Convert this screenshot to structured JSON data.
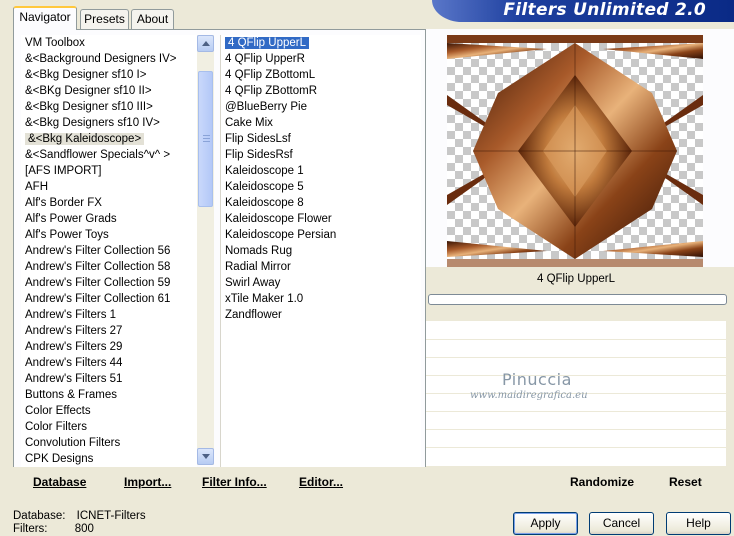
{
  "banner": {
    "title": "Filters Unlimited 2.0"
  },
  "tabs": [
    {
      "label": "Navigator",
      "active": true
    },
    {
      "label": "Presets",
      "active": false
    },
    {
      "label": "About",
      "active": false
    }
  ],
  "categories": {
    "items": [
      "VM Toolbox",
      "&<Background Designers IV>",
      "&<Bkg Designer sf10 I>",
      "&<BKg Designer sf10 II>",
      "&<Bkg Designer sf10 III>",
      "&<Bkg Designers sf10 IV>",
      "&<Bkg Kaleidoscope>",
      "&<Sandflower Specials^v^ >",
      "[AFS IMPORT]",
      "AFH",
      "Alf's Border FX",
      "Alf's Power Grads",
      "Alf's Power Toys",
      "Andrew's Filter Collection 56",
      "Andrew's Filter Collection 58",
      "Andrew's Filter Collection 59",
      "Andrew's Filter Collection 61",
      "Andrew's Filters 1",
      "Andrew's Filters 27",
      "Andrew's Filters 29",
      "Andrew's Filters 44",
      "Andrew's Filters 51",
      "Buttons & Frames",
      "Color Effects",
      "Color Filters",
      "Convolution Filters",
      "CPK Designs"
    ],
    "selected_index": 6
  },
  "filters": {
    "items": [
      "4 QFlip UpperL",
      "4 QFlip UpperR",
      "4 QFlip ZBottomL",
      "4 QFlip ZBottomR",
      "@BlueBerry Pie",
      "Cake Mix",
      "Flip SidesLsf",
      "Flip SidesRsf",
      "Kaleidoscope 1",
      "Kaleidoscope 5",
      "Kaleidoscope 8",
      "Kaleidoscope Flower",
      "Kaleidoscope Persian",
      "Nomads Rug",
      "Radial Mirror",
      "Swirl Away",
      "xTile Maker 1.0",
      "Zandflower"
    ],
    "selected_index": 0
  },
  "toolbar": {
    "database": "Database",
    "import": "Import...",
    "filter_info": "Filter Info...",
    "editor": "Editor...",
    "randomize": "Randomize",
    "reset": "Reset"
  },
  "preview": {
    "caption": "4 QFlip UpperL",
    "progress": 0
  },
  "watermark": {
    "name": "Pinuccia",
    "url": "www.maidiregrafica.eu"
  },
  "status": {
    "database_label": "Database:",
    "database_value": "ICNET-Filters",
    "filters_label": "Filters:",
    "filters_value": "800"
  },
  "buttons": {
    "apply": "Apply",
    "cancel": "Cancel",
    "help": "Help"
  },
  "colors": {
    "accent_blue": "#316ac5",
    "banner_blue": "#0a2a86",
    "face": "#ece9d8"
  }
}
